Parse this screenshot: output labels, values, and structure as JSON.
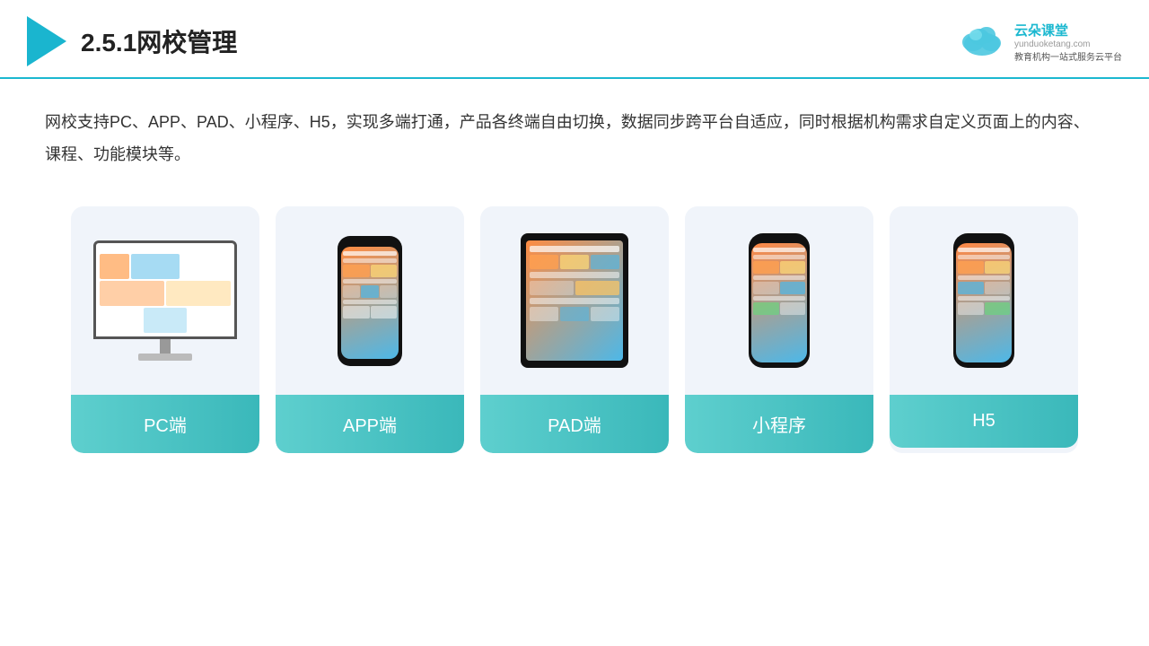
{
  "header": {
    "title": "2.5.1网校管理",
    "logo": {
      "name": "云朵课堂",
      "url": "yunduoketang.com",
      "slogan": "教育机构一站式服务云平台"
    }
  },
  "description": {
    "text": "网校支持PC、APP、PAD、小程序、H5，实现多端打通，产品各终端自由切换，数据同步跨平台自适应，同时根据机构需求自定义页面上的内容、课程、功能模块等。"
  },
  "cards": [
    {
      "id": "pc",
      "label": "PC端"
    },
    {
      "id": "app",
      "label": "APP端"
    },
    {
      "id": "pad",
      "label": "PAD端"
    },
    {
      "id": "miniprogram",
      "label": "小程序"
    },
    {
      "id": "h5",
      "label": "H5"
    }
  ]
}
